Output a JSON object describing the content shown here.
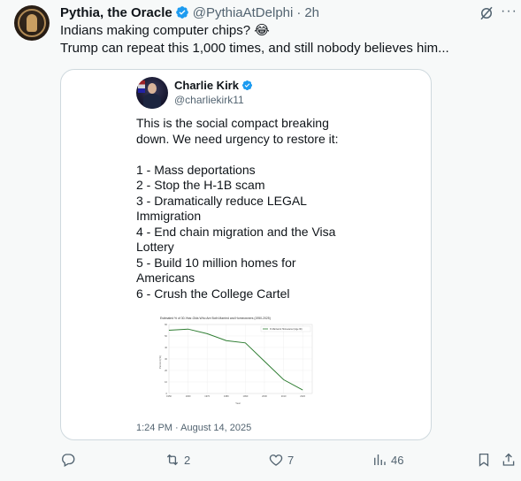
{
  "post": {
    "author_name": "Pythia, the Oracle",
    "handle": "@PythiaAtDelphi",
    "separator": "·",
    "time": "2h",
    "lines": [
      "Indians making computer chips? 😂",
      "Trump can repeat this 1,000 times, and still nobody believes him..."
    ]
  },
  "quoted": {
    "author_name": "Charlie Kirk",
    "handle": "@charliekirk11",
    "intro": [
      "This is the social compact breaking",
      "down. We need urgency to restore it:"
    ],
    "list": [
      "1 - Mass deportations",
      "2 - Stop the H-1B scam",
      "3 - Dramatically reduce LEGAL",
      "Immigration",
      "4 - End chain migration and the Visa",
      "Lottery",
      "5 - Build 10 million homes for",
      "Americans",
      "6 - Crush the College Cartel"
    ],
    "timestamp": "1:24 PM · August 14, 2025"
  },
  "chart_data": {
    "type": "line",
    "title": "Estimated % of 30-Year-Olds Who Are Both Married and Homeowners (1950-2025)",
    "xlabel": "Year",
    "ylabel": "Percent (%)",
    "x": [
      1950,
      1960,
      1970,
      1980,
      1990,
      2000,
      2010,
      2020
    ],
    "series": [
      {
        "name": "% Married & Homeowner (Age 30)",
        "values": [
          55,
          56,
          52,
          46,
          44,
          28,
          12,
          3
        ]
      }
    ],
    "xlim": [
      1950,
      2025
    ],
    "ylim": [
      0,
      60
    ],
    "x_ticks": [
      1950,
      1960,
      1970,
      1980,
      1990,
      2000,
      2010,
      2020
    ],
    "grid": true,
    "legend": "top-right",
    "color": "#2e7d32"
  },
  "actions": {
    "reply_count": "",
    "repost_count": "2",
    "like_count": "7",
    "view_count": "46"
  },
  "colors": {
    "verified": "#1d9bf0",
    "muted": "#536471",
    "text": "#0f1419"
  },
  "icons": [
    "verified-badge-icon",
    "grok-icon",
    "more-icon",
    "reply-icon",
    "repost-icon",
    "like-icon",
    "views-icon",
    "bookmark-icon",
    "share-icon"
  ]
}
